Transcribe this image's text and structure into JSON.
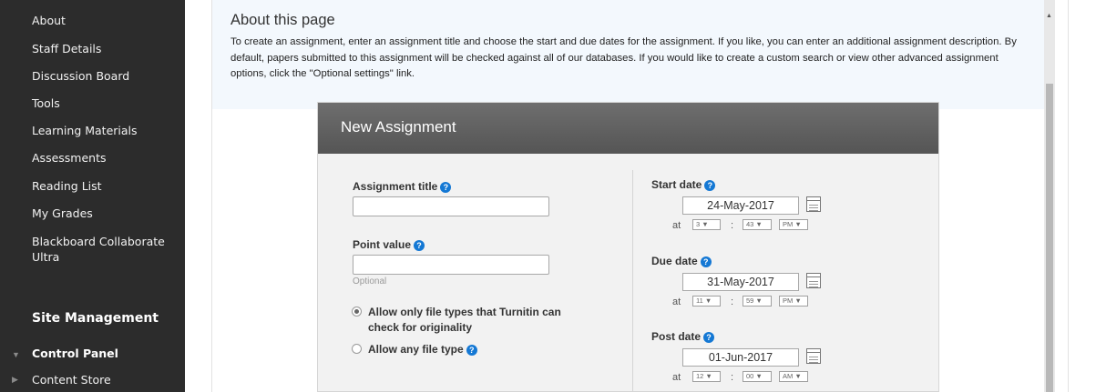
{
  "sidebar": {
    "items": [
      {
        "label": "About"
      },
      {
        "label": "Staff Details"
      },
      {
        "label": "Discussion Board"
      },
      {
        "label": "Tools"
      },
      {
        "label": "Learning Materials"
      },
      {
        "label": "Assessments"
      },
      {
        "label": "Reading List"
      },
      {
        "label": "My Grades"
      },
      {
        "label": "Blackboard Collaborate Ultra"
      }
    ],
    "section_heading": "Site Management",
    "control_panel": "Control Panel",
    "content_store": "Content Store"
  },
  "about": {
    "title": "About this page",
    "text": "To create an assignment, enter an assignment title and choose the start and due dates for the assignment. If you like, you can enter an additional assignment description. By default, papers submitted to this assignment will be checked against all of our databases. If you would like to create a custom search or view other advanced assignment options, click the \"Optional settings\" link."
  },
  "form": {
    "heading": "New Assignment",
    "assignment_title_label": "Assignment title",
    "assignment_title_value": "",
    "point_value_label": "Point value",
    "point_value_value": "",
    "optional_hint": "Optional",
    "radio_turnitin": "Allow only file types that Turnitin can check for originality",
    "radio_any": "Allow any file type",
    "help_glyph": "?",
    "start": {
      "label": "Start date",
      "date": "24-May-2017",
      "hour": "3",
      "minute": "43",
      "ampm": "PM"
    },
    "due": {
      "label": "Due date",
      "date": "31-May-2017",
      "hour": "11",
      "minute": "59",
      "ampm": "PM"
    },
    "post": {
      "label": "Post date",
      "date": "01-Jun-2017",
      "hour": "12",
      "minute": "00",
      "ampm": "AM"
    },
    "at_label": "at",
    "colon": ":"
  }
}
